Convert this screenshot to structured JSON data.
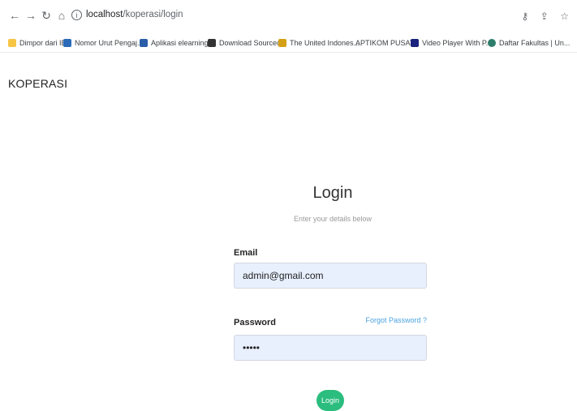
{
  "browser": {
    "url_host": "localhost",
    "url_path": "/koperasi/login",
    "bookmarks": [
      {
        "label": "Dimpor dari IE",
        "icon": "folder-icon",
        "color": "#f6c544"
      },
      {
        "label": "Nomor Urut Pengaj...",
        "icon": "doc-icon",
        "color": "#2a6ab8"
      },
      {
        "label": "Aplikasi elearning...",
        "icon": "elearning-icon",
        "color": "#2b5ea8"
      },
      {
        "label": "Download Sourcec...",
        "icon": "source-icon",
        "color": "#333333"
      },
      {
        "label": "The United Indones...",
        "icon": "garuda-icon",
        "color": "#d4a017"
      },
      {
        "label": "APTIKOM PUSAT",
        "icon": "",
        "color": ""
      },
      {
        "label": "Video Player With P...",
        "icon": "video-icon",
        "color": "#1a237e"
      },
      {
        "label": "Daftar Fakultas | Un...",
        "icon": "globe-icon",
        "color": "#2e7d6b"
      }
    ]
  },
  "app": {
    "brand": "KOPERASI"
  },
  "login": {
    "title": "Login",
    "subtitle": "Enter your details below",
    "email_label": "Email",
    "email_value": "admin@gmail.com",
    "password_label": "Password",
    "password_value": "•••••",
    "forgot_label": "Forgot Password ?",
    "button_label": "Login"
  },
  "colors": {
    "accent": "#2bbd7e",
    "link": "#4aa3df",
    "input_bg": "#e8f0fe"
  }
}
